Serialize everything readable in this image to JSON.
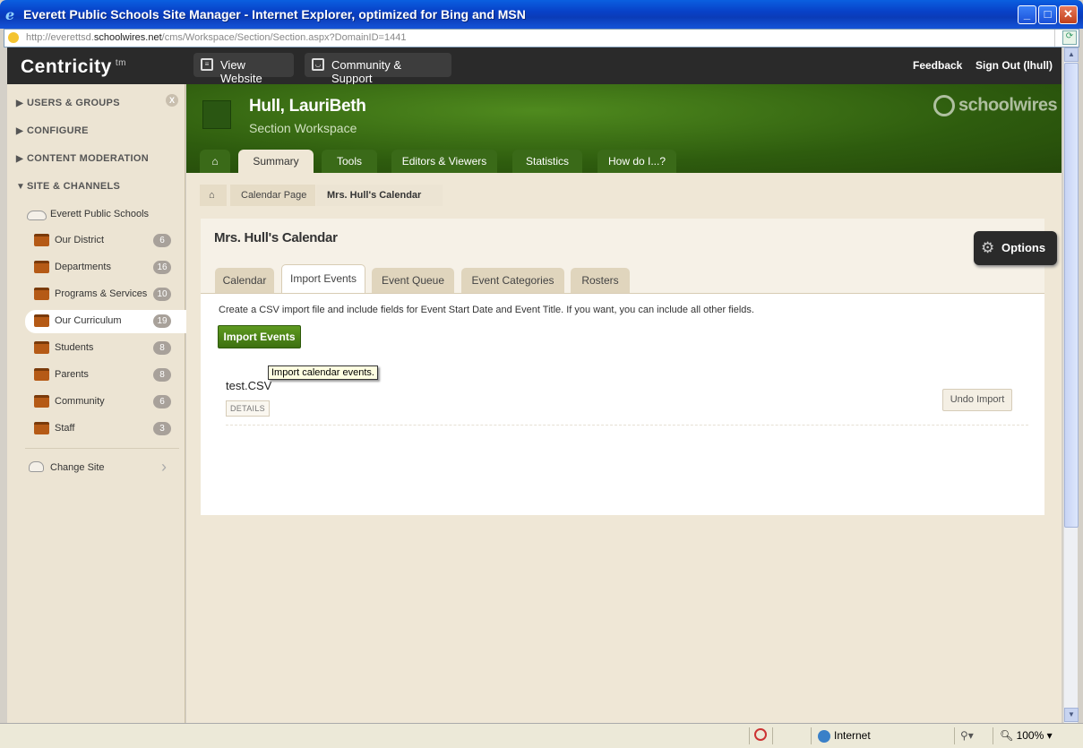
{
  "window": {
    "title": "Everett Public Schools Site Manager - Internet Explorer, optimized for Bing and MSN",
    "controls": [
      "_",
      "□",
      "✕"
    ]
  },
  "address": {
    "prefix": "http://everettsd.",
    "host": "schoolwires.net",
    "path": "/cms/Workspace/Section/Section.aspx?DomainID=1441"
  },
  "appbar": {
    "brand": "Centricity",
    "brand_tm": "tm",
    "view_website": "View Website",
    "community_support": "Community & Support",
    "feedback": "Feedback",
    "sign_out": "Sign Out (lhull)"
  },
  "sidebar": {
    "close": "X",
    "groups": [
      {
        "label": "USERS & GROUPS",
        "arrow": "▶"
      },
      {
        "label": "CONFIGURE",
        "arrow": "▶"
      },
      {
        "label": "CONTENT MODERATION",
        "arrow": "▶"
      },
      {
        "label": "SITE & CHANNELS",
        "arrow": "▼"
      }
    ],
    "site_name": "Everett Public Schools",
    "channels": [
      {
        "label": "Our District",
        "count": "6"
      },
      {
        "label": "Departments",
        "count": "16"
      },
      {
        "label": "Programs & Services",
        "count": "10"
      },
      {
        "label": "Our Curriculum",
        "count": "19"
      },
      {
        "label": "Students",
        "count": "8"
      },
      {
        "label": "Parents",
        "count": "8"
      },
      {
        "label": "Community",
        "count": "6"
      },
      {
        "label": "Staff",
        "count": "3"
      }
    ],
    "change_site": "Change Site",
    "change_site_arrow": "›"
  },
  "workspace": {
    "user_name": "Hull, LauriBeth",
    "subtitle": "Section Workspace",
    "logo_text": "schoolwires",
    "tabs": [
      "Summary",
      "Tools",
      "Editors & Viewers",
      "Statistics",
      "How do I...?"
    ],
    "selected_tab": "Summary"
  },
  "breadcrumb": [
    "Calendar Page",
    "Mrs. Hull's Calendar"
  ],
  "panel": {
    "title": "Mrs. Hull's Calendar",
    "options_label": "Options",
    "tabs": [
      "Calendar",
      "Import Events",
      "Event Queue",
      "Event Categories",
      "Rosters"
    ],
    "selected_tab": "Import Events",
    "description": "Create a CSV import file and include fields for Event Start Date and Event Title. If you want, you can include all other fields.",
    "import_button": "Import Events",
    "tooltip": "Import calendar events.",
    "file_name": "test.CSV",
    "details_button": "DETAILS",
    "undo_button": "Undo Import"
  },
  "statusbar": {
    "zone": "Internet",
    "zoom": "100%"
  },
  "colors": {
    "accent_green": "#3d7010",
    "appbar_dark": "#2a2a2a",
    "sidebar_bg": "#ece4d3"
  }
}
